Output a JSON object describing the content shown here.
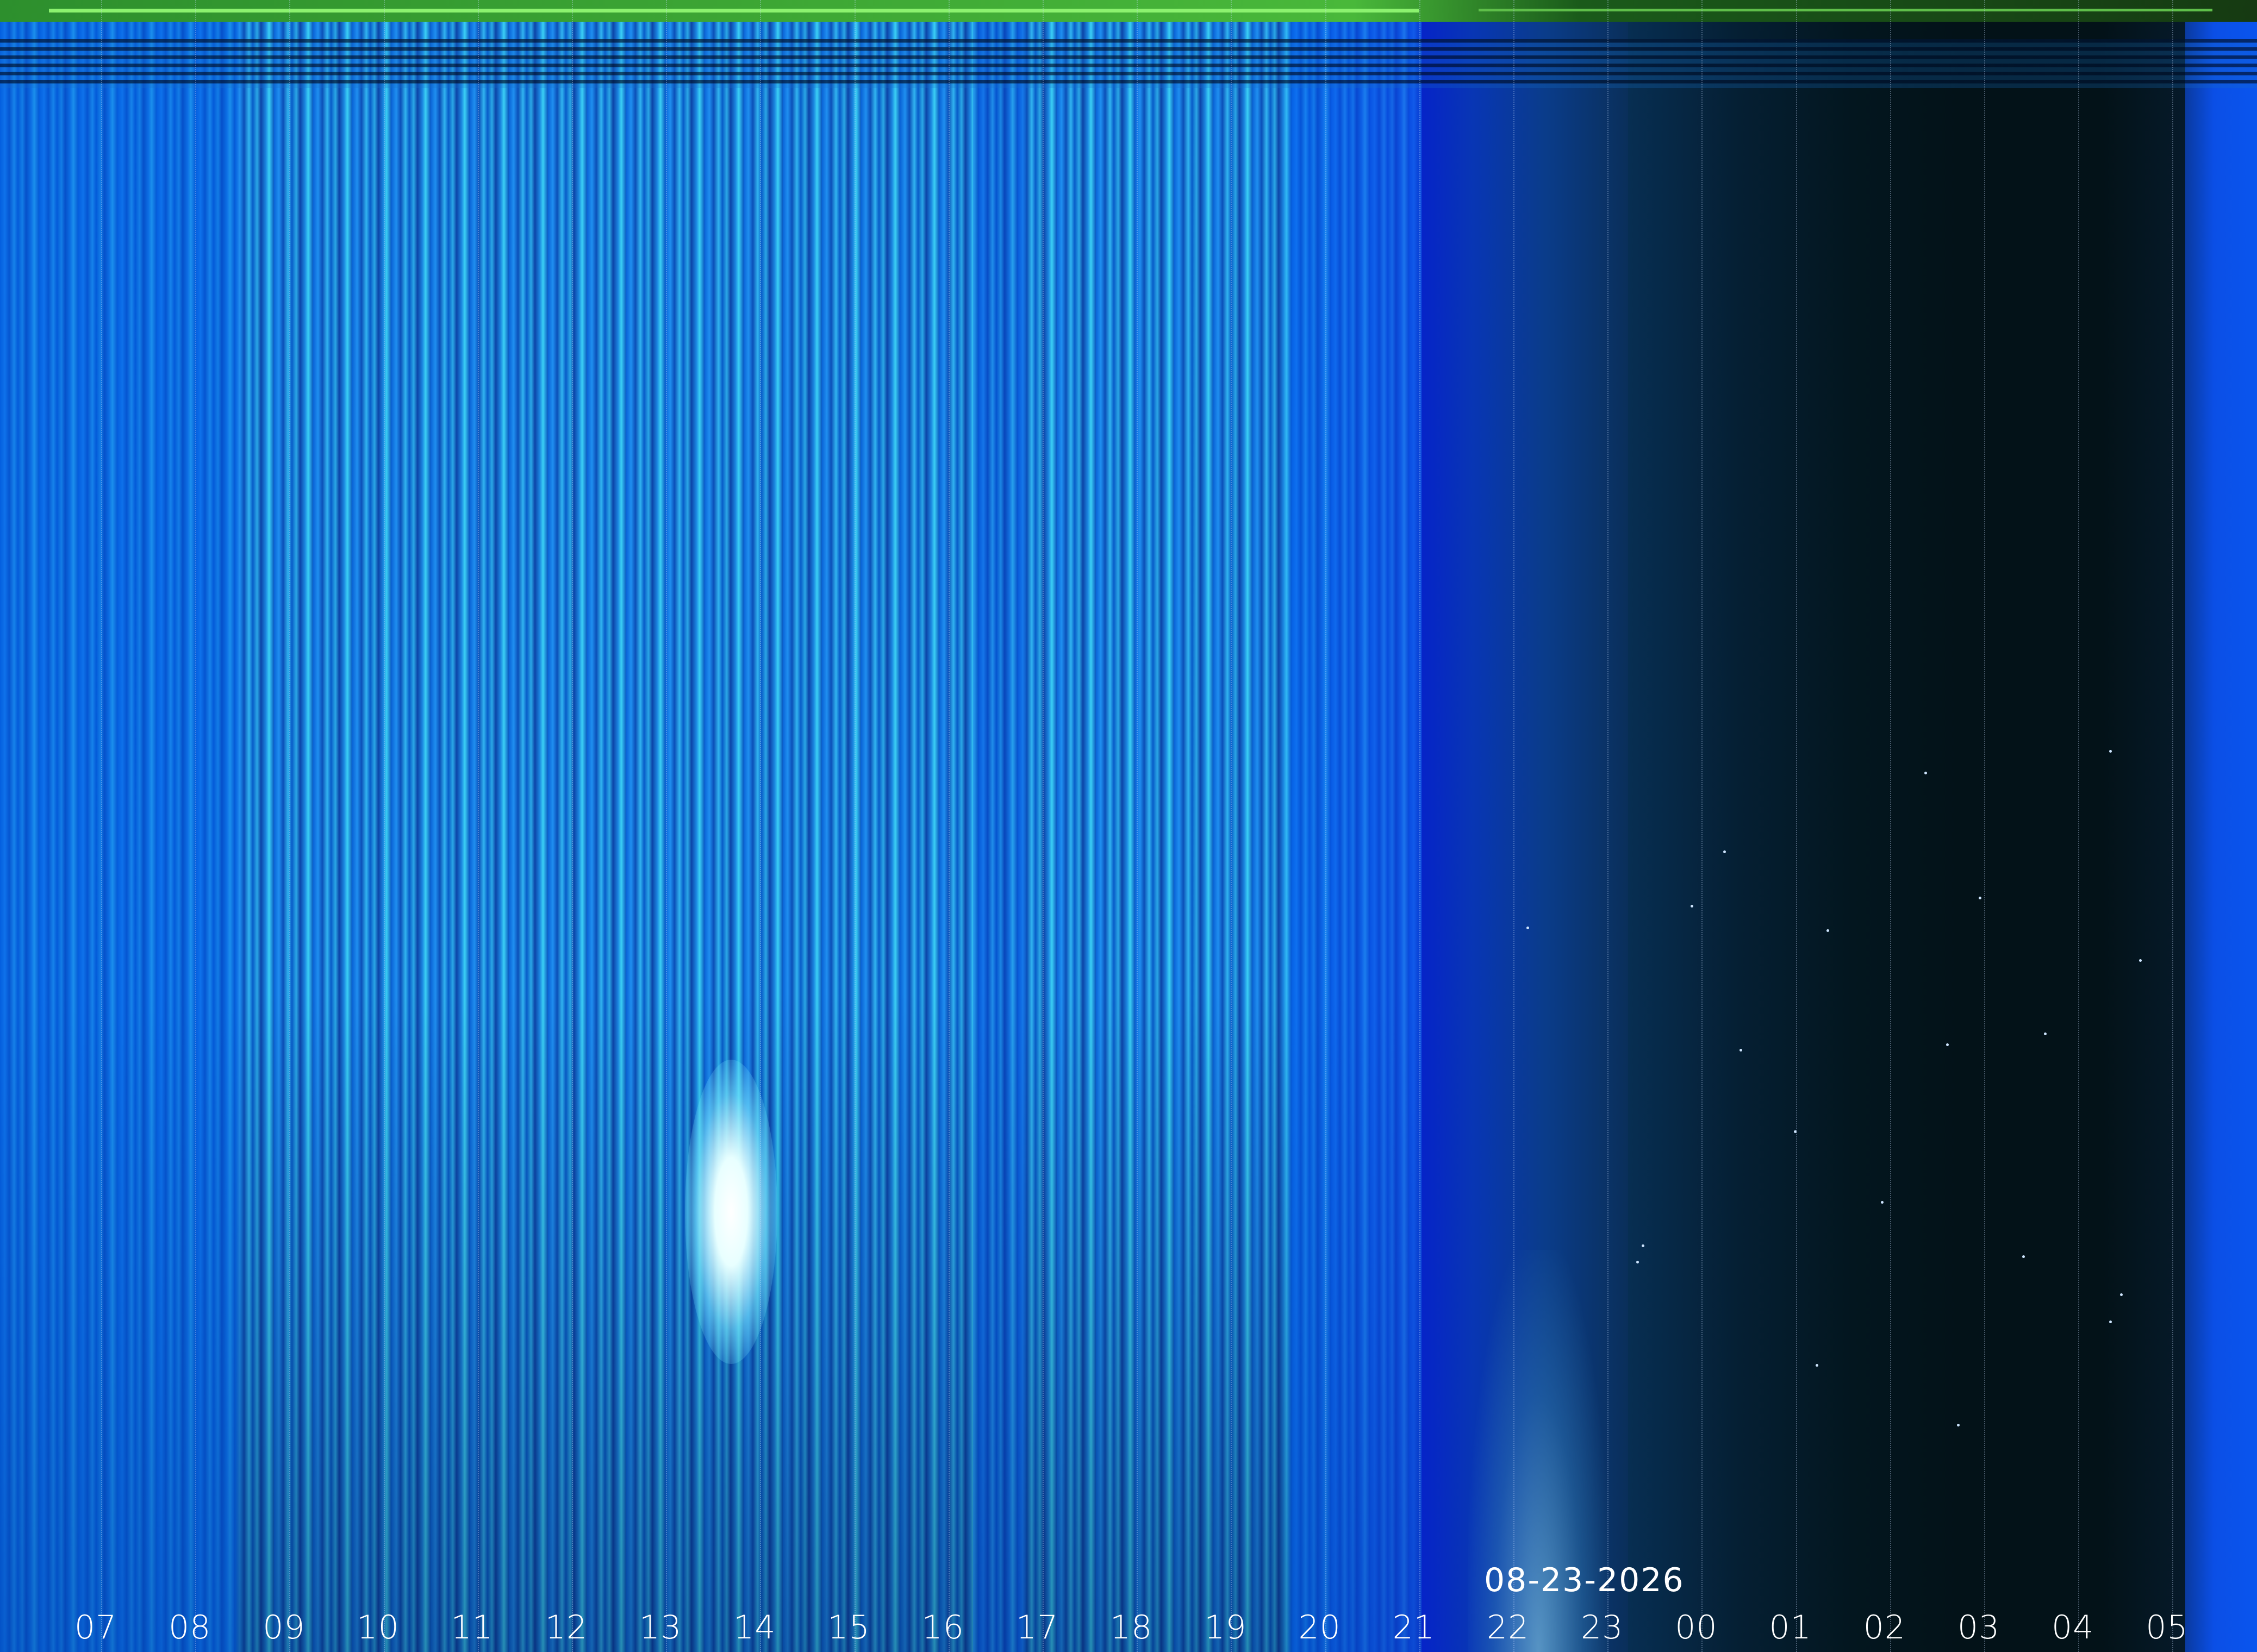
{
  "keogram": {
    "date": "08-23-2026",
    "hours": [
      "07",
      "08",
      "09",
      "10",
      "11",
      "12",
      "13",
      "14",
      "15",
      "16",
      "17",
      "18",
      "19",
      "20",
      "21",
      "22",
      "23",
      "00",
      "01",
      "02",
      "03",
      "04",
      "05"
    ],
    "colors": {
      "day": "#1f8ff0",
      "dusk": "#0624c8",
      "night": "#031218",
      "dawn": "#0b4fe6",
      "top_bar": "#49b83a",
      "label": "#ffffff"
    }
  }
}
